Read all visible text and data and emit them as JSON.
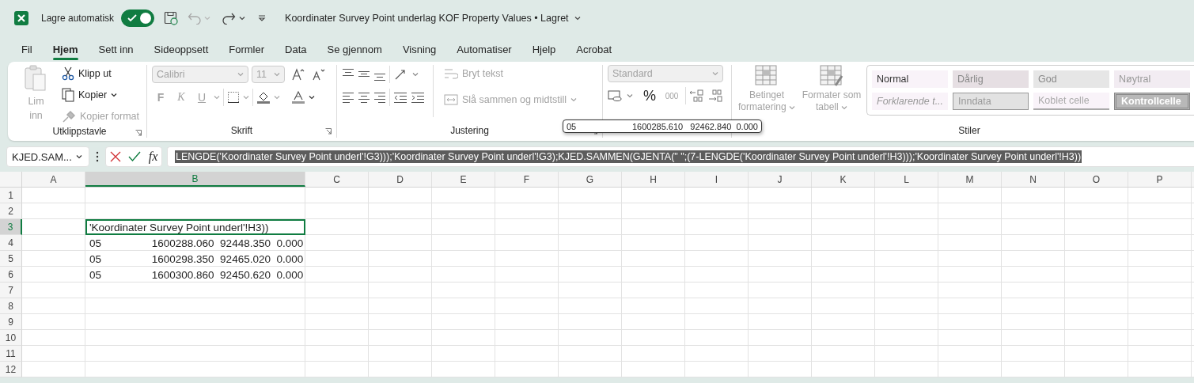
{
  "title_bar": {
    "autosave_label": "Lagre automatisk",
    "autosave_on": true,
    "document_title": "Koordinater Survey Point underlag KOF Property Values • Lagret"
  },
  "menu_tabs": [
    {
      "label": "Fil",
      "selected": false
    },
    {
      "label": "Hjem",
      "selected": true
    },
    {
      "label": "Sett inn",
      "selected": false
    },
    {
      "label": "Sideoppsett",
      "selected": false
    },
    {
      "label": "Formler",
      "selected": false
    },
    {
      "label": "Data",
      "selected": false
    },
    {
      "label": "Se gjennom",
      "selected": false
    },
    {
      "label": "Visning",
      "selected": false
    },
    {
      "label": "Automatiser",
      "selected": false
    },
    {
      "label": "Hjelp",
      "selected": false
    },
    {
      "label": "Acrobat",
      "selected": false
    }
  ],
  "ribbon": {
    "clipboard": {
      "label": "Utklippstavle",
      "paste": {
        "label": "Lim inn",
        "disabled": true
      },
      "cut": {
        "label": "Klipp ut",
        "disabled": false
      },
      "copy": {
        "label": "Kopier",
        "disabled": false
      },
      "format_painter": {
        "label": "Kopier format",
        "disabled": true
      }
    },
    "font": {
      "label": "Skrift",
      "font_name": {
        "value": "Calibri",
        "disabled": true
      },
      "font_size": {
        "value": "11",
        "disabled": true
      },
      "bold": {
        "label": "F",
        "disabled": true
      },
      "italic": {
        "label": "K",
        "disabled": true
      },
      "underline": {
        "label": "U",
        "disabled": true
      }
    },
    "alignment": {
      "label": "Justering",
      "wrap_text": {
        "label": "Bryt tekst",
        "disabled": true
      },
      "merge_center": {
        "label": "Slå sammen og midtstill",
        "disabled": true
      }
    },
    "number": {
      "number_format": {
        "value": "Standard",
        "disabled": true
      },
      "percent": {
        "label": "%",
        "disabled": false
      },
      "thousands": {
        "label": "000",
        "disabled": true
      }
    },
    "styles": {
      "label": "Stiler",
      "conditional_formatting": {
        "label": "Betinget formatering",
        "disabled": true
      },
      "format_as_table": {
        "label": "Formater som tabell",
        "disabled": true
      },
      "cell_styles": [
        {
          "label": "Normal"
        },
        {
          "label": "Dårlig"
        },
        {
          "label": "God"
        },
        {
          "label": "Nøytral"
        },
        {
          "label": "Forklarende t..."
        },
        {
          "label": "Inndata"
        },
        {
          "label": "Koblet celle"
        },
        {
          "label": "Kontrollcelle"
        }
      ]
    }
  },
  "formula_bar": {
    "name_box": "KJED.SAM...",
    "function_label": "fx",
    "formula": "LENGDE('Koordinater Survey Point underl'!G3)));'Koordinater Survey Point underl'!G3);KJED.SAMMEN(GJENTA(\" \";(7-LENGDE('Koordinater Survey Point underl'!H3)));'Koordinater Survey Point underl'!H3))",
    "formula_selected": true
  },
  "tooltip": {
    "first": "05",
    "rest": "1600285.610   92462.840  0.000"
  },
  "grid": {
    "columns": [
      {
        "label": "A",
        "selected": false
      },
      {
        "label": "B",
        "selected": true
      },
      {
        "label": "C",
        "selected": false
      },
      {
        "label": "D",
        "selected": false
      },
      {
        "label": "E",
        "selected": false
      },
      {
        "label": "F",
        "selected": false
      },
      {
        "label": "G",
        "selected": false
      },
      {
        "label": "H",
        "selected": false
      },
      {
        "label": "I",
        "selected": false
      },
      {
        "label": "J",
        "selected": false
      },
      {
        "label": "K",
        "selected": false
      },
      {
        "label": "L",
        "selected": false
      },
      {
        "label": "M",
        "selected": false
      },
      {
        "label": "N",
        "selected": false
      },
      {
        "label": "O",
        "selected": false
      },
      {
        "label": "P",
        "selected": false
      }
    ],
    "rows": [
      {
        "label": "1",
        "selected": false
      },
      {
        "label": "2",
        "selected": false
      },
      {
        "label": "3",
        "selected": true,
        "column_b": "'Koordinater Survey Point underl'!H3))"
      },
      {
        "label": "4",
        "selected": false,
        "column_b": "05                 1600288.060  92448.350  0.000"
      },
      {
        "label": "5",
        "selected": false,
        "column_b": "05                 1600298.350  92465.020  0.000"
      },
      {
        "label": "6",
        "selected": false,
        "column_b": "05                 1600300.860  92450.620  0.000"
      },
      {
        "label": "7",
        "selected": false
      },
      {
        "label": "8",
        "selected": false
      },
      {
        "label": "9",
        "selected": false
      },
      {
        "label": "10",
        "selected": false
      },
      {
        "label": "11",
        "selected": false
      },
      {
        "label": "12",
        "selected": false
      }
    ]
  }
}
